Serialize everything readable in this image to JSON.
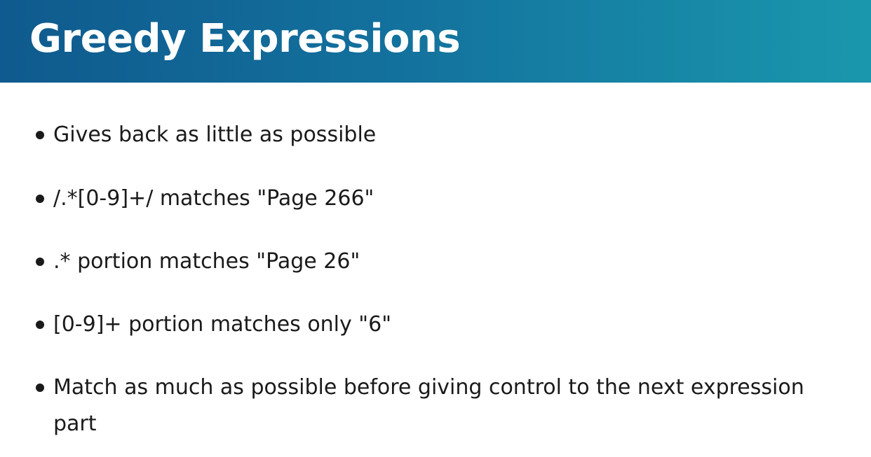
{
  "slide": {
    "title": "Greedy Expressions",
    "header_gradient": [
      "#0f5a8e",
      "#1a97ad"
    ],
    "bullets": [
      "Gives back as little as possible",
      "/.*[0-9]+/ matches \"Page 266\"",
      ".* portion matches \"Page 26\"",
      "[0-9]+ portion matches only \"6\"",
      "Match as much as possible before giving control to the next expression part"
    ]
  }
}
